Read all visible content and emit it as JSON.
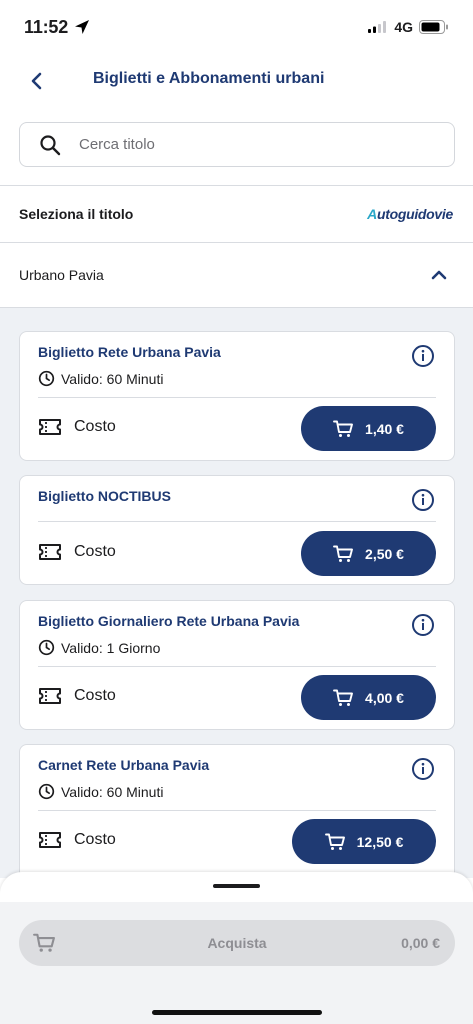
{
  "status_bar": {
    "time": "11:52",
    "network": "4G"
  },
  "nav": {
    "title": "Biglietti e Abbonamenti urbani"
  },
  "search": {
    "placeholder": "Cerca titolo"
  },
  "section": {
    "label": "Seleziona il titolo",
    "brand": "utoguidovie",
    "brand_initial": "A"
  },
  "accordion": {
    "label": "Urbano Pavia",
    "expanded": true
  },
  "tickets": [
    {
      "title": "Biglietto Rete Urbana Pavia",
      "validity": "Valido: 60 Minuti",
      "cost_label": "Costo",
      "price": "1,40 €"
    },
    {
      "title": "Biglietto NOCTIBUS",
      "validity": "",
      "cost_label": "Costo",
      "price": "2,50 €"
    },
    {
      "title": "Biglietto Giornaliero Rete Urbana Pavia",
      "validity": "Valido: 1 Giorno",
      "cost_label": "Costo",
      "price": "4,00 €"
    },
    {
      "title": "Carnet Rete Urbana Pavia",
      "validity": "Valido: 60 Minuti",
      "cost_label": "Costo",
      "price": "12,50 €"
    }
  ],
  "cart": {
    "button_label": "Acquista",
    "total": "0,00 €"
  },
  "colors": {
    "primary": "#1f3a73",
    "brand_accent": "#2aa7c8",
    "list_background": "#eef1f5",
    "disabled": "#dcdde0"
  },
  "icons": {
    "back": "chevron-left-icon",
    "search": "search-icon",
    "collapse": "chevron-up-icon",
    "info": "info-icon",
    "clock": "clock-icon",
    "ticket": "ticket-icon",
    "cart": "cart-icon"
  }
}
